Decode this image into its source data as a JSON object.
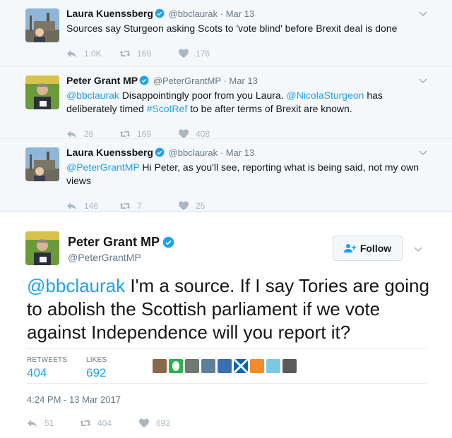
{
  "replies": [
    {
      "name": "Laura Kuenssberg",
      "handle": "@bbclaurak",
      "date": "Mar 13",
      "text_parts": [
        {
          "text": "Sources say Sturgeon asking Scots to 'vote blind' before Brexit deal is done",
          "link": false
        }
      ],
      "replies": "1.0K",
      "retweets": "169",
      "likes": "176"
    },
    {
      "name": "Peter Grant MP",
      "handle": "@PeterGrantMP",
      "date": "Mar 13",
      "text_parts": [
        {
          "text": "@bbclaurak",
          "link": true
        },
        {
          "text": " Disappointingly poor from you Laura. ",
          "link": false
        },
        {
          "text": "@NicolaSturgeon",
          "link": true
        },
        {
          "text": " has deliberately timed ",
          "link": false
        },
        {
          "text": "#ScotRef",
          "link": true
        },
        {
          "text": " to be after terms of Brexit are known.",
          "link": false
        }
      ],
      "replies": "26",
      "retweets": "169",
      "likes": "408"
    },
    {
      "name": "Laura Kuenssberg",
      "handle": "@bbclaurak",
      "date": "Mar 13",
      "text_parts": [
        {
          "text": "@PeterGrantMP",
          "link": true
        },
        {
          "text": " Hi Peter, as you'll see, reporting what is being said, not my own views",
          "link": false
        }
      ],
      "replies": "146",
      "retweets": "7",
      "likes": "25"
    }
  ],
  "main": {
    "name": "Peter Grant MP",
    "handle": "@PeterGrantMP",
    "follow_label": "Follow",
    "text_parts": [
      {
        "text": "@bbclaurak",
        "link": true
      },
      {
        "text": " I'm a source. If I say Tories are going to abolish the Scottish parliament if we vote against Independence will you report it?",
        "link": false
      }
    ],
    "retweets_label": "RETWEETS",
    "retweets": "404",
    "likes_label": "LIKES",
    "likes": "692",
    "timestamp": "4:24 PM - 13 Mar 2017",
    "reply_count": "51",
    "retweet_count": "404",
    "like_count": "692"
  },
  "colors": {
    "accent": "#1da1f2",
    "muted": "#657786",
    "icon": "#aab8c2"
  }
}
